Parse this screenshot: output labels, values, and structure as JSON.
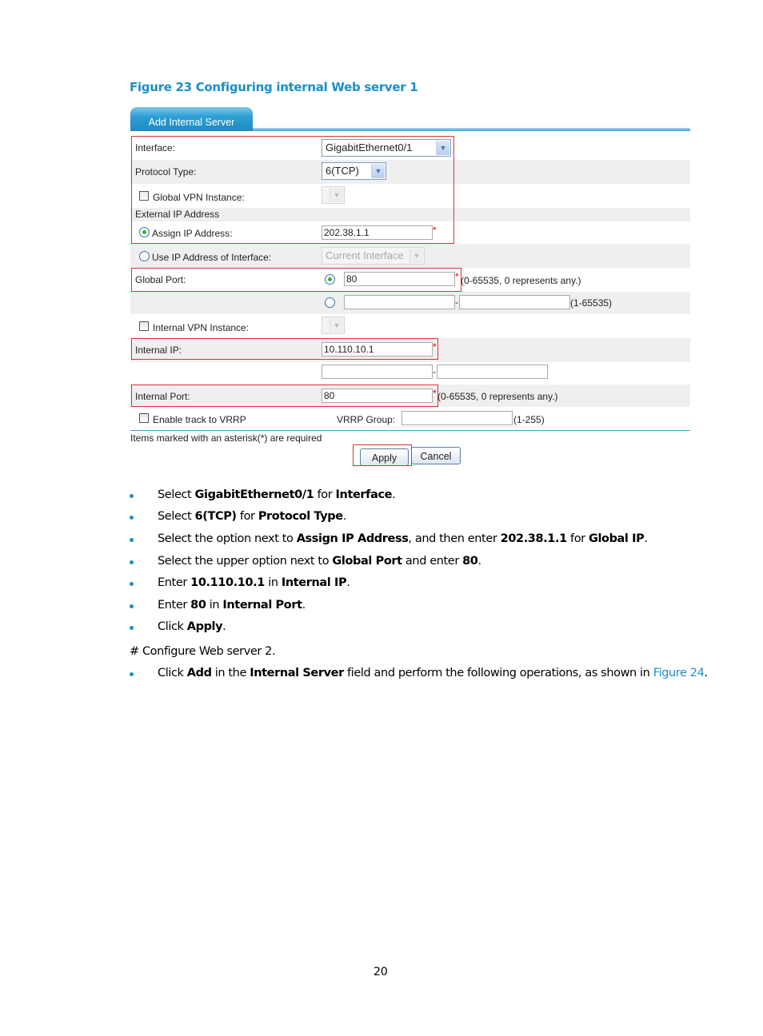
{
  "figure": {
    "title": "Figure 23 Configuring internal Web server 1"
  },
  "form": {
    "tab_label": "Add Internal Server",
    "interface": {
      "label": "Interface:",
      "value": "GigabitEthernet0/1"
    },
    "protocol_type": {
      "label": "Protocol Type:",
      "value": "6(TCP)"
    },
    "global_vpn": {
      "label": "Global VPN Instance:",
      "checked": false
    },
    "external_ip_heading": "External IP Address",
    "assign_ip": {
      "label": "Assign IP Address:",
      "value": "202.38.1.1",
      "selected": true
    },
    "use_interface_ip": {
      "label": "Use IP Address of Interface:",
      "value": "Current Interface",
      "selected": false
    },
    "global_port": {
      "label": "Global Port:",
      "value": "80",
      "hint": "(0-65535, 0 represents any.)",
      "range_hint": "(1-65535)",
      "range_from": "",
      "range_to": ""
    },
    "internal_vpn": {
      "label": "Internal VPN Instance:",
      "checked": false
    },
    "internal_ip": {
      "label": "Internal IP:",
      "value": "10.110.10.1",
      "range_from": "",
      "range_to": ""
    },
    "internal_port": {
      "label": "Internal Port:",
      "value": "80",
      "hint": "(0-65535, 0 represents any.)"
    },
    "vrrp_track": {
      "label": "Enable track to VRRP",
      "checked": false
    },
    "vrrp_group": {
      "label": "VRRP Group:",
      "value": "",
      "hint": "(1-255)"
    },
    "required_note": "Items marked with an asterisk(*) are required",
    "asterisk": "*",
    "dash": "-",
    "apply_label": "Apply",
    "cancel_label": "Cancel",
    "highlight_color": "#e03030",
    "accent_color": "#1a8fc9"
  },
  "steps": [
    {
      "parts": [
        [
          "Select ",
          false
        ],
        [
          "GigabitEthernet0/1",
          true
        ],
        [
          " for ",
          false
        ],
        [
          "Interface",
          true
        ],
        [
          ".",
          false
        ]
      ]
    },
    {
      "parts": [
        [
          "Select ",
          false
        ],
        [
          "6(TCP)",
          true
        ],
        [
          " for ",
          false
        ],
        [
          "Protocol Type",
          true
        ],
        [
          ".",
          false
        ]
      ]
    },
    {
      "parts": [
        [
          "Select the option next to ",
          false
        ],
        [
          "Assign IP Address",
          true
        ],
        [
          ", and then enter ",
          false
        ],
        [
          "202.38.1.1",
          true
        ],
        [
          " for ",
          false
        ],
        [
          "Global IP",
          true
        ],
        [
          ".",
          false
        ]
      ]
    },
    {
      "parts": [
        [
          "Select the upper option next to ",
          false
        ],
        [
          "Global Port",
          true
        ],
        [
          " and enter ",
          false
        ],
        [
          "80",
          true
        ],
        [
          ".",
          false
        ]
      ]
    },
    {
      "parts": [
        [
          "Enter ",
          false
        ],
        [
          "10.110.10.1",
          true
        ],
        [
          " in ",
          false
        ],
        [
          "Internal IP",
          true
        ],
        [
          ".",
          false
        ]
      ]
    },
    {
      "parts": [
        [
          "Enter ",
          false
        ],
        [
          "80",
          true
        ],
        [
          " in ",
          false
        ],
        [
          "Internal Port",
          true
        ],
        [
          ".",
          false
        ]
      ]
    },
    {
      "parts": [
        [
          "Click ",
          false
        ],
        [
          "Apply",
          true
        ],
        [
          ".",
          false
        ]
      ]
    }
  ],
  "configure_note": "# Configure Web server 2.",
  "step2": {
    "parts": [
      [
        "Click ",
        false
      ],
      [
        "Add",
        true
      ],
      [
        " in the ",
        false
      ],
      [
        "Internal Server",
        true
      ],
      [
        " field and perform the following operations, as shown in ",
        false
      ]
    ],
    "link": "Figure 24",
    "end": "."
  },
  "page_number": "20"
}
